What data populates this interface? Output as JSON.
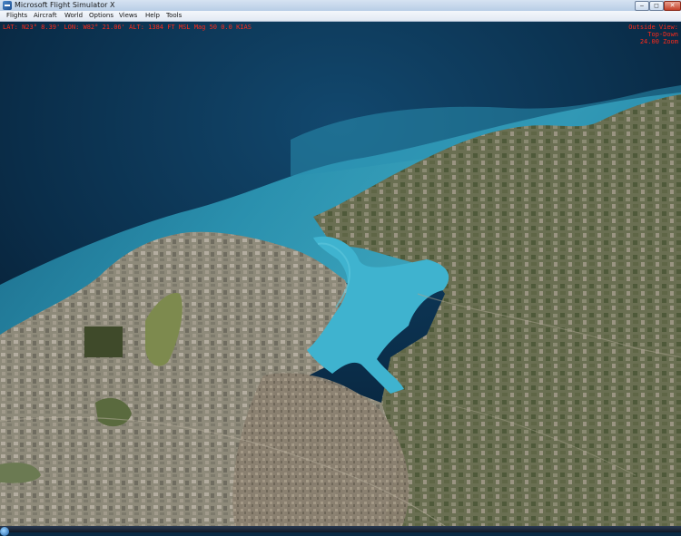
{
  "window": {
    "title": "Microsoft Flight Simulator X",
    "controls": {
      "minimize": "‒",
      "maximize": "◻",
      "close": "✕"
    }
  },
  "menu": {
    "flights": "Flights",
    "aircraft": "Aircraft",
    "world": "World",
    "options": "Options",
    "views": "Views",
    "help": "Help",
    "tools": "Tools"
  },
  "hud": {
    "coords": "LAT: N23° 8.39'  LON: W82° 21.06'  ALT: 1384 FT  MSL  Mag 50  0.0 KIAS",
    "view_mode": "Outside View:",
    "view_type": "Top-Down",
    "zoom": "24.00 Zoom"
  },
  "colors": {
    "hud_text": "#ff2a1a",
    "deep_ocean": "#0a2a44",
    "shallow_water": "#36a9c4",
    "bay_water": "#3fb3cf"
  },
  "icons": {
    "app": "flight-sim-app-icon"
  }
}
